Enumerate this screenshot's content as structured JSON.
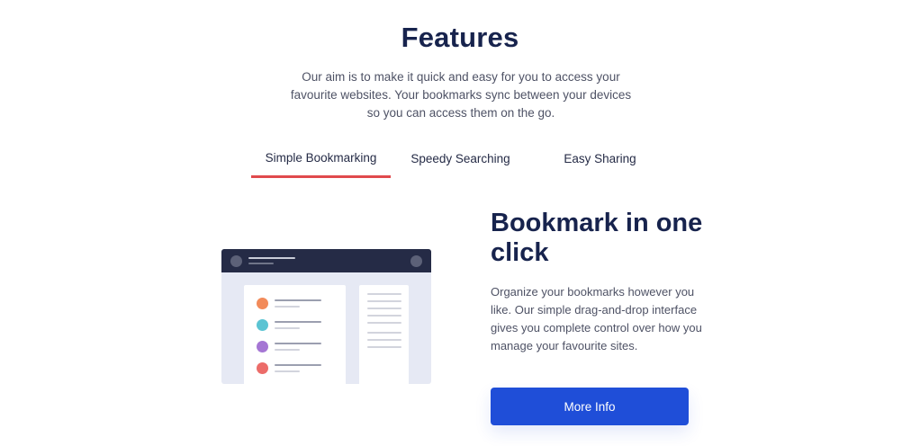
{
  "features": {
    "title": "Features",
    "intro": "Our aim is to make it quick and easy for you to access your favourite websites. Your bookmarks sync between your devices so you can access them on the go."
  },
  "tabs": [
    {
      "label": "Simple Bookmarking",
      "active": true
    },
    {
      "label": "Speedy Searching",
      "active": false
    },
    {
      "label": "Easy Sharing",
      "active": false
    }
  ],
  "panel": {
    "heading": "Bookmark in one click",
    "description": "Organize your bookmarks however you like. Our simple drag-and-drop interface gives you complete control over how you manage your favourite sites.",
    "button_label": "More Info"
  },
  "colors": {
    "navy": "#17234d",
    "accent_red": "#e04a4d",
    "button_blue": "#1f4ed8",
    "illustration_bg": "#e6e9f4",
    "bookmark_dots": [
      "#f28b5a",
      "#5bc4d3",
      "#a576d4",
      "#ec6c69"
    ]
  }
}
